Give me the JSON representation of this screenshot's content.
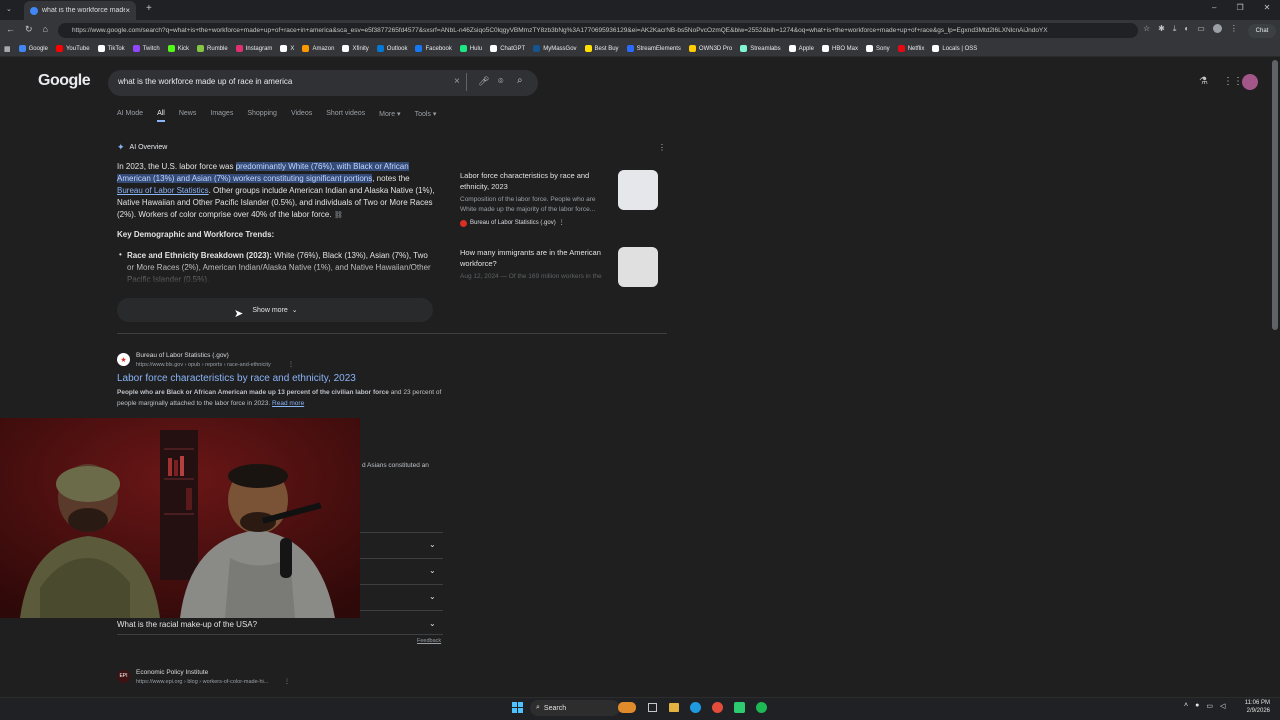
{
  "browser": {
    "tab_title": "what is the workforce made up of",
    "tab_close": "×",
    "new_tab": "+",
    "url": "https://www.google.com/search?q=what+is+the+workforce+made+up+of+race+in+america&sca_esv=e5f3877265fd4577&sxsrf=ANbL-n46Zsiqo5C0lqgyVBMmzTY8zb3bNg%3A1770695936129&ei=AK2KacrNB-bs5NoPvcOzmQE&biw=2552&bih=1274&oq=what+is+the+workforce+made+up+of+race&gs_lp=Egxnd3Mtd2l6LXNlcnAiJndoYX",
    "window_controls": [
      "–",
      "❐",
      "✕"
    ]
  },
  "bookmarks": [
    {
      "label": "Google",
      "color": "#4285f4"
    },
    {
      "label": "YouTube",
      "color": "#ff0000"
    },
    {
      "label": "TikTok",
      "color": "#ffffff"
    },
    {
      "label": "Twitch",
      "color": "#9146ff"
    },
    {
      "label": "Kick",
      "color": "#53fc18"
    },
    {
      "label": "Rumble",
      "color": "#85c742"
    },
    {
      "label": "Instagram",
      "color": "#e1306c"
    },
    {
      "label": "X",
      "color": "#ffffff"
    },
    {
      "label": "Amazon",
      "color": "#ff9900"
    },
    {
      "label": "Xfinity",
      "color": "#ffffff"
    },
    {
      "label": "Outlook",
      "color": "#0078d4"
    },
    {
      "label": "Facebook",
      "color": "#1877f2"
    },
    {
      "label": "Hulu",
      "color": "#1ce783"
    },
    {
      "label": "ChatGPT",
      "color": "#ffffff"
    },
    {
      "label": "MyMassGov",
      "color": "#14558f"
    },
    {
      "label": "Best Buy",
      "color": "#ffe000"
    },
    {
      "label": "StreamElements",
      "color": "#2a6bff"
    },
    {
      "label": "OWN3D Pro",
      "color": "#ffcc00"
    },
    {
      "label": "Streamlabs",
      "color": "#80f5d2"
    },
    {
      "label": "Apple",
      "color": "#ffffff"
    },
    {
      "label": "HBO Max",
      "color": "#ffffff"
    },
    {
      "label": "Sony",
      "color": "#ffffff"
    },
    {
      "label": "Netflix",
      "color": "#e50914"
    },
    {
      "label": "Locals | OSS",
      "color": "#ffffff"
    }
  ],
  "google": {
    "logo": "Google",
    "query": "what is the workforce made up of race in america",
    "tabs": [
      "AI Mode",
      "All",
      "News",
      "Images",
      "Shopping",
      "Videos",
      "Short videos",
      "More",
      "Tools"
    ],
    "active_tab": "All"
  },
  "ai_overview": {
    "label": "AI Overview",
    "p1_a": "In 2023, the U.S. labor force was ",
    "p1_hl": "predominantly White (76%), with Black or African American (13%) and Asian (7%) workers constituting significant portions",
    "p1_b": ", notes the ",
    "p1_link": "Bureau of Labor Statistics",
    "p1_c": ". Other groups include American Indian and Alaska Native (1%), Native Hawaiian and Other Pacific Islander (0.5%), and individuals of Two or More Races (2%). Workers of color comprise over 40% of the labor force.",
    "trends_heading": "Key Demographic and Workforce Trends:",
    "trend1_bold": "Race and Ethnicity Breakdown (2023):",
    "trend1_text": " White (76%), Black (13%), Asian (7%), Two or More Races (2%), American Indian/Alaska Native (1%), and Native Hawaiian/Other Pacific Islander (0.5%).",
    "show_more": "Show more",
    "sources": [
      {
        "title": "Labor force characteristics by race and ethnicity, 2023",
        "desc": "Composition of the labor force. People who are White made up the majority of the labor force...",
        "site": "Bureau of Labor Statistics (.gov)"
      },
      {
        "title": "How many immigrants are in the American workforce?",
        "desc": "Aug 12, 2024 — Of the 169 million workers in the"
      }
    ]
  },
  "result1": {
    "site": "Bureau of Labor Statistics (.gov)",
    "url": "https://www.bls.gov › opub › reports › race-and-ethnicity",
    "title": "Labor force characteristics by race and ethnicity, 2023",
    "snippet_bold": "People who are Black or African American made up 13 percent of the civilian labor force",
    "snippet_rest": " and 23 percent of people marginally attached to the labor force in 2023.",
    "read_more": "Read more",
    "partial": "d Asians constituted an"
  },
  "faq": {
    "last_question": "What is the racial make-up of the USA?",
    "feedback": "Feedback"
  },
  "result2": {
    "site": "Economic Policy Institute",
    "url": "https://www.epi.org › blog › workers-of-color-made-hi..."
  },
  "taskbar": {
    "search": "Search",
    "time": "11:06 PM",
    "date": "2/9/2026"
  }
}
